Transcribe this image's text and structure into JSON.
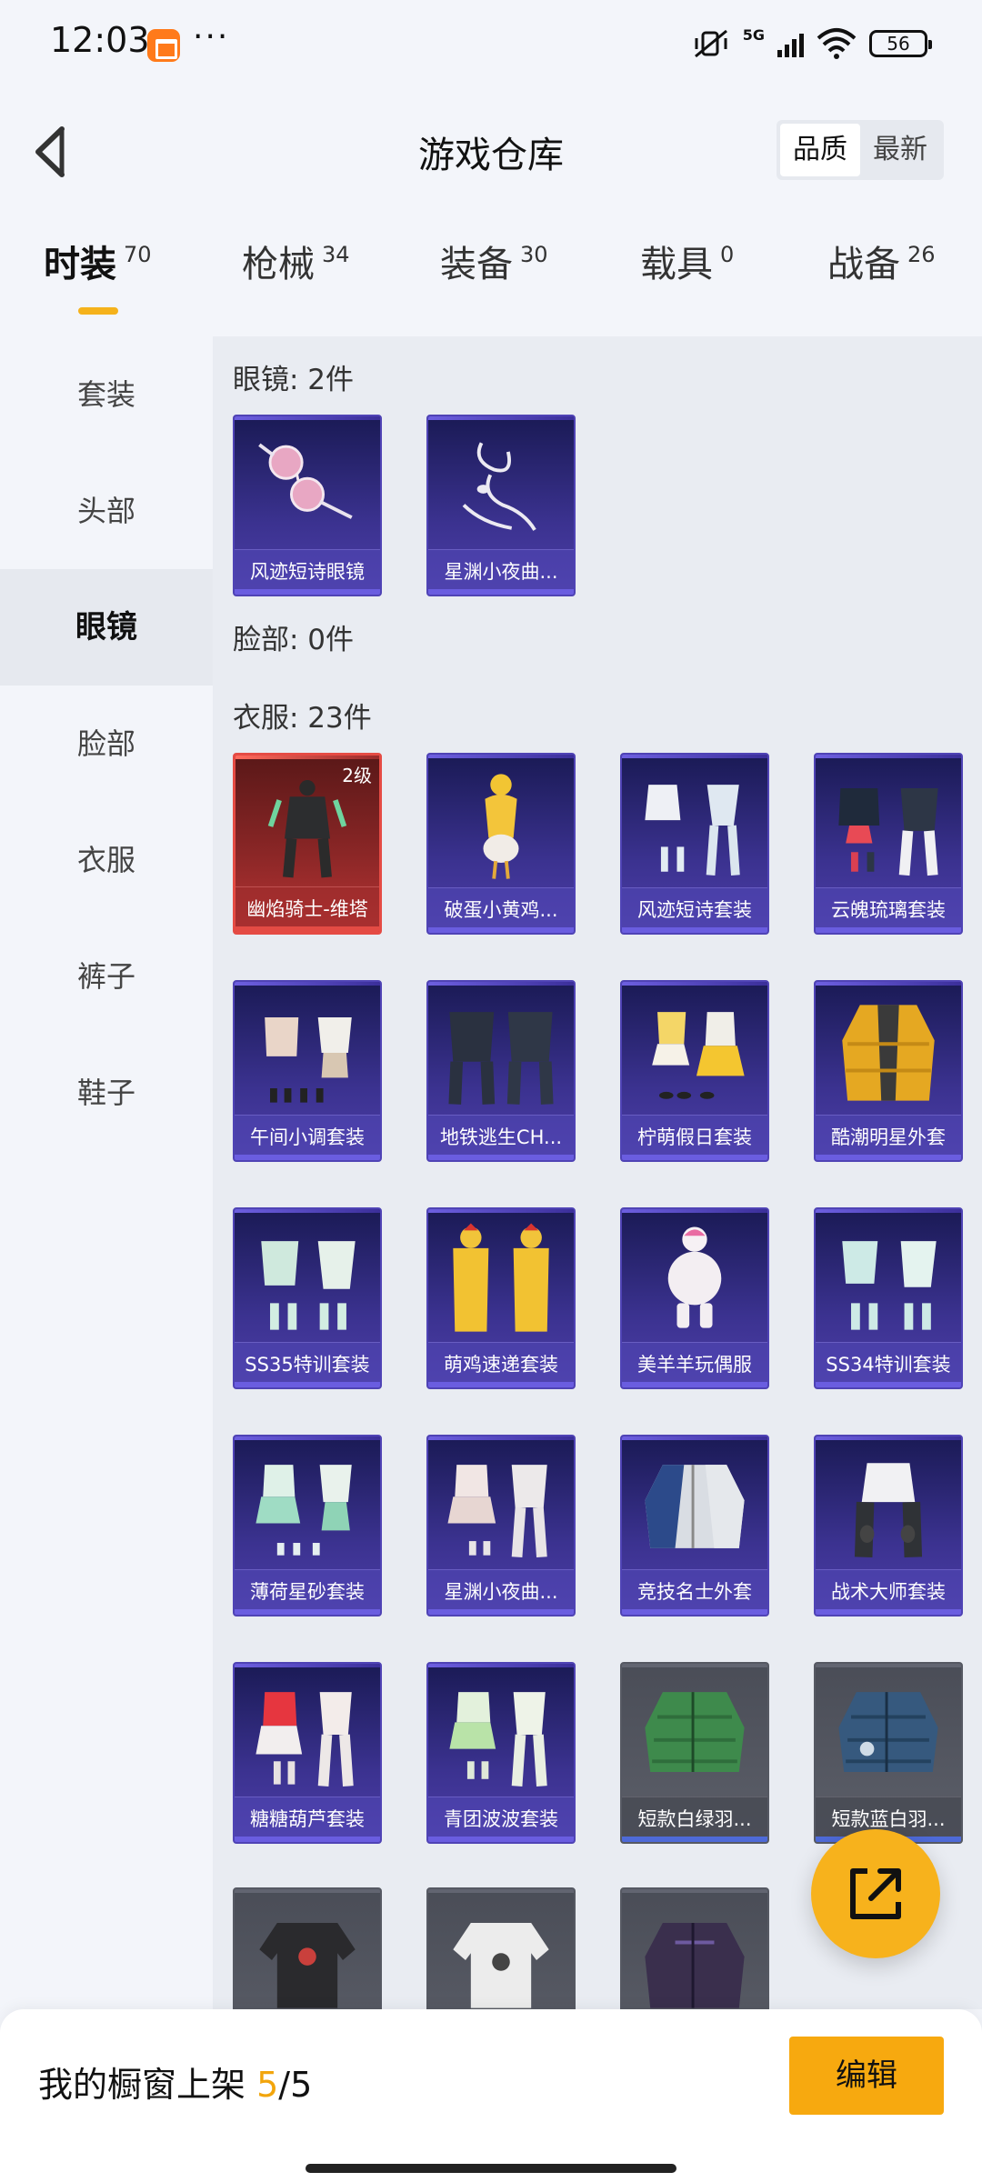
{
  "status": {
    "time": "12:03",
    "dots": "···",
    "network": "5G",
    "battery": "56"
  },
  "header": {
    "title": "游戏仓库",
    "sort": {
      "quality": "品质",
      "latest": "最新"
    }
  },
  "tabs": [
    {
      "label": "时装",
      "count": "70"
    },
    {
      "label": "枪械",
      "count": "34"
    },
    {
      "label": "装备",
      "count": "30"
    },
    {
      "label": "载具",
      "count": "0"
    },
    {
      "label": "战备",
      "count": "26"
    }
  ],
  "sidebar": {
    "items": [
      {
        "label": "套装"
      },
      {
        "label": "头部"
      },
      {
        "label": "眼镜"
      },
      {
        "label": "脸部"
      },
      {
        "label": "衣服"
      },
      {
        "label": "裤子"
      },
      {
        "label": "鞋子"
      }
    ]
  },
  "sections": {
    "glasses": {
      "title": "眼镜: 2件",
      "items": [
        "风迹短诗眼镜",
        "星渊小夜曲..."
      ]
    },
    "face": {
      "title": "脸部: 0件"
    },
    "clothes": {
      "title": "衣服: 23件",
      "level_badge": "2级",
      "items": [
        "幽焰骑士-维塔",
        "破蛋小黄鸡...",
        "风迹短诗套装",
        "云魄琉璃套装",
        "午间小调套装",
        "地铁逃生CH...",
        "柠萌假日套装",
        "酷潮明星外套",
        "SS35特训套装",
        "萌鸡速递套装",
        "美羊羊玩偶服",
        "SS34特训套装",
        "薄荷星砂套装",
        "星渊小夜曲...",
        "竞技名士外套",
        "战术大师套装",
        "糖糖葫芦套装",
        "青团波波套装",
        "短款白绿羽...",
        "短款蓝白羽..."
      ]
    }
  },
  "footer": {
    "label": "我的橱窗上架",
    "count_current": "5",
    "count_sep": "/",
    "count_total": "5",
    "edit": "编辑"
  }
}
